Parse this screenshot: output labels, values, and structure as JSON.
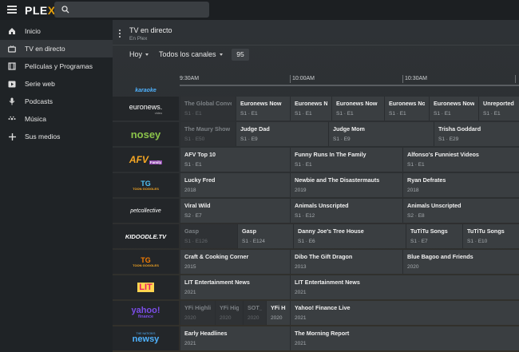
{
  "app": {
    "logo_main": "PLE",
    "logo_accent": "X"
  },
  "sidebar": {
    "items": [
      {
        "label": "Inicio",
        "icon": "home-icon"
      },
      {
        "label": "TV en directo",
        "icon": "tv-icon",
        "active": true
      },
      {
        "label": "Películas y Programas",
        "icon": "film-icon"
      },
      {
        "label": "Serie web",
        "icon": "play-icon"
      },
      {
        "label": "Podcasts",
        "icon": "microphone-icon"
      },
      {
        "label": "Música",
        "icon": "music-icon"
      },
      {
        "label": "Sus medios",
        "icon": "plus-icon"
      }
    ]
  },
  "header": {
    "title": "TV en directo",
    "subtitle": "En Plex"
  },
  "filters": {
    "day": "Hoy",
    "channels": "Todos los canales",
    "count": "95"
  },
  "guide": {
    "times": [
      "9:30AM",
      "10:00AM",
      "10:30AM"
    ],
    "channels": [
      {
        "logo": "karaoke",
        "programs": []
      },
      {
        "logo": "euronews.",
        "logo_sub": "video",
        "programs": [
          {
            "title": "The Global Conver",
            "meta": "S1 · E1",
            "past": true
          },
          {
            "title": "Euronews Now",
            "meta": "S1 · E1"
          },
          {
            "title": "Euronews Now",
            "meta": "S1 · E1"
          },
          {
            "title": "Euronews Now",
            "meta": "S1 · E1"
          },
          {
            "title": "Euronews Now",
            "meta": "S1 · E1"
          },
          {
            "title": "Euronews Now",
            "meta": "S1 · E1"
          },
          {
            "title": "Unreported I",
            "meta": "S1 · E1"
          }
        ]
      },
      {
        "logo": "nosey",
        "programs": [
          {
            "title": "The Maury Show",
            "meta": "S1 · E50",
            "past": true
          },
          {
            "title": "Judge Dad",
            "meta": "S1 · E9"
          },
          {
            "title": "Judge Mom",
            "meta": "S1 · E9"
          },
          {
            "title": "Trisha Goddard",
            "meta": "S1 · E29"
          }
        ]
      },
      {
        "logo": "AFV",
        "logo_sub": "Family",
        "programs": [
          {
            "title": "AFV Top 10",
            "meta": "S1 · E1"
          },
          {
            "title": "Funny Runs In The Family",
            "meta": "S1 · E1"
          },
          {
            "title": "Alfonso's Funniest Videos",
            "meta": "S1 · E1"
          }
        ]
      },
      {
        "logo": "TG",
        "logo_sub": "TOON GOGGLES",
        "programs": [
          {
            "title": "Lucky Fred",
            "meta": "2018"
          },
          {
            "title": "Newbie and The Disastermauts",
            "meta": "2019"
          },
          {
            "title": "Ryan Defrates",
            "meta": "2018"
          }
        ]
      },
      {
        "logo": "petcollective",
        "programs": [
          {
            "title": "Viral Wild",
            "meta": "S2 · E7"
          },
          {
            "title": "Animals Unscripted",
            "meta": "S1 · E12"
          },
          {
            "title": "Animals Unscripted",
            "meta": "S2 · E8"
          }
        ]
      },
      {
        "logo": "KIDOODLE.TV",
        "programs": [
          {
            "title": "Gasp",
            "meta": "S1 · E126",
            "past": true
          },
          {
            "title": "Gasp",
            "meta": "S1 · E124"
          },
          {
            "title": "Danny Joe's Tree House",
            "meta": "S1 · E6"
          },
          {
            "title": "TuTiTu Songs",
            "meta": "S1 · E7"
          },
          {
            "title": "TuTiTu Songs",
            "meta": "S1 · E10"
          }
        ]
      },
      {
        "logo": "TG",
        "logo_sub": "TOON GOGGLES",
        "programs": [
          {
            "title": "Craft & Cooking Corner",
            "meta": "2015"
          },
          {
            "title": "Dibo The Gift Dragon",
            "meta": "2013"
          },
          {
            "title": "Blue Bagoo and Friends",
            "meta": "2020"
          }
        ]
      },
      {
        "logo": "LIT",
        "programs": [
          {
            "title": "LIT Entertainment News",
            "meta": "2021"
          },
          {
            "title": "LIT Entertainment News",
            "meta": "2021"
          }
        ]
      },
      {
        "logo": "yahoo!",
        "logo_sub": "finance",
        "programs": [
          {
            "title": "YFi Highlight",
            "meta": "2020",
            "past": true
          },
          {
            "title": "YFi Highli",
            "meta": "2020",
            "past": true
          },
          {
            "title": "SOT_YH",
            "meta": "2020",
            "past": true
          },
          {
            "title": "YFi High",
            "meta": "2020"
          },
          {
            "title": "Yahoo! Finance Live",
            "meta": "2021"
          }
        ]
      },
      {
        "logo": "newsy",
        "logo_sub": "THE NATION'S",
        "programs": [
          {
            "title": "Early Headlines",
            "meta": "2021"
          },
          {
            "title": "The Morning Report",
            "meta": "2021"
          }
        ]
      }
    ]
  },
  "colors": {
    "accent": "#e5a00d",
    "sidebar_bg": "#1f2326",
    "cell_bg": "#3a3e41"
  }
}
